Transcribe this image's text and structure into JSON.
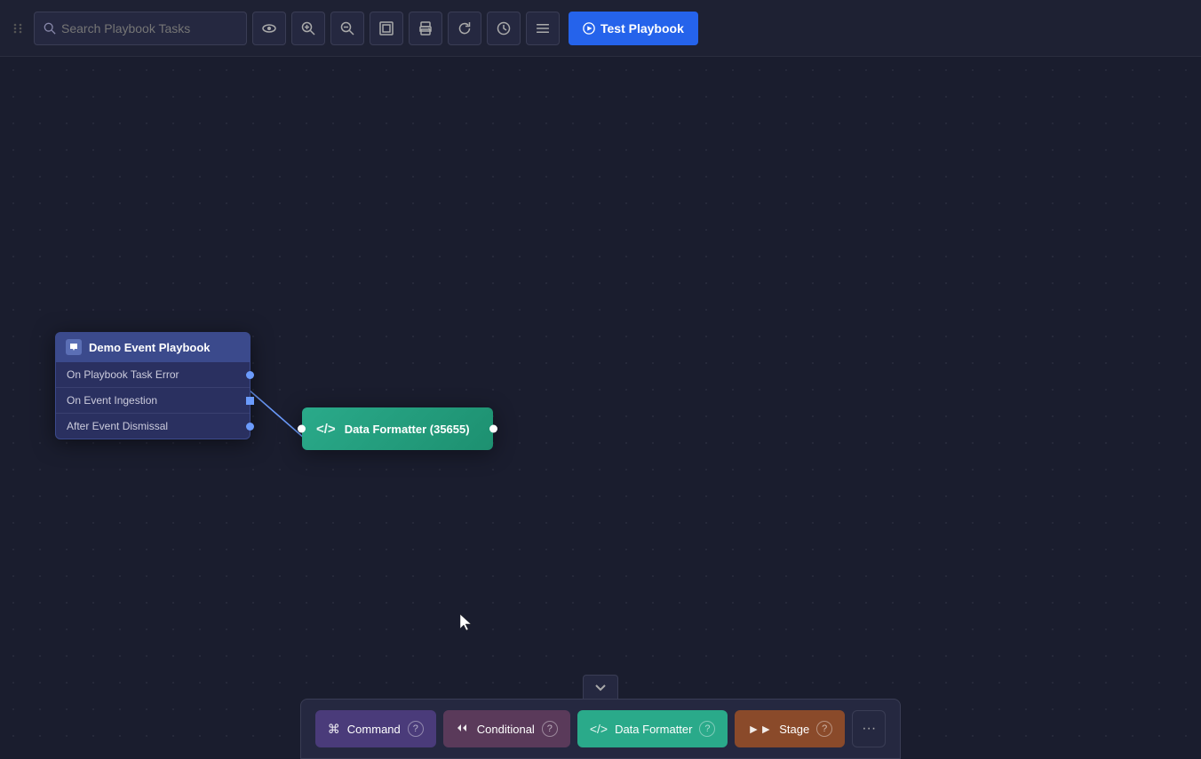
{
  "toolbar": {
    "search_placeholder": "Search Playbook Tasks",
    "test_playbook_label": "Test Playbook",
    "drag_handle_title": "drag"
  },
  "nodes": {
    "demo_event": {
      "title": "Demo Event Playbook",
      "rows": [
        {
          "label": "On Playbook Task Error",
          "connector": "dot"
        },
        {
          "label": "On Event Ingestion",
          "connector": "square"
        },
        {
          "label": "After Event Dismissal",
          "connector": "dot"
        }
      ]
    },
    "data_formatter": {
      "label": "Data Formatter (35655)"
    }
  },
  "bottom_panel": {
    "collapse_label": "▾",
    "task_types": [
      {
        "key": "command",
        "label": "Command",
        "icon": "⌘",
        "style": "command"
      },
      {
        "key": "conditional",
        "label": "Conditional",
        "icon": "⊳",
        "style": "conditional"
      },
      {
        "key": "data-formatter",
        "label": "Data Formatter",
        "icon": "</>",
        "style": "data-formatter"
      },
      {
        "key": "stage",
        "label": "Stage",
        "icon": "▶▶",
        "style": "stage"
      }
    ],
    "more_label": "···"
  }
}
